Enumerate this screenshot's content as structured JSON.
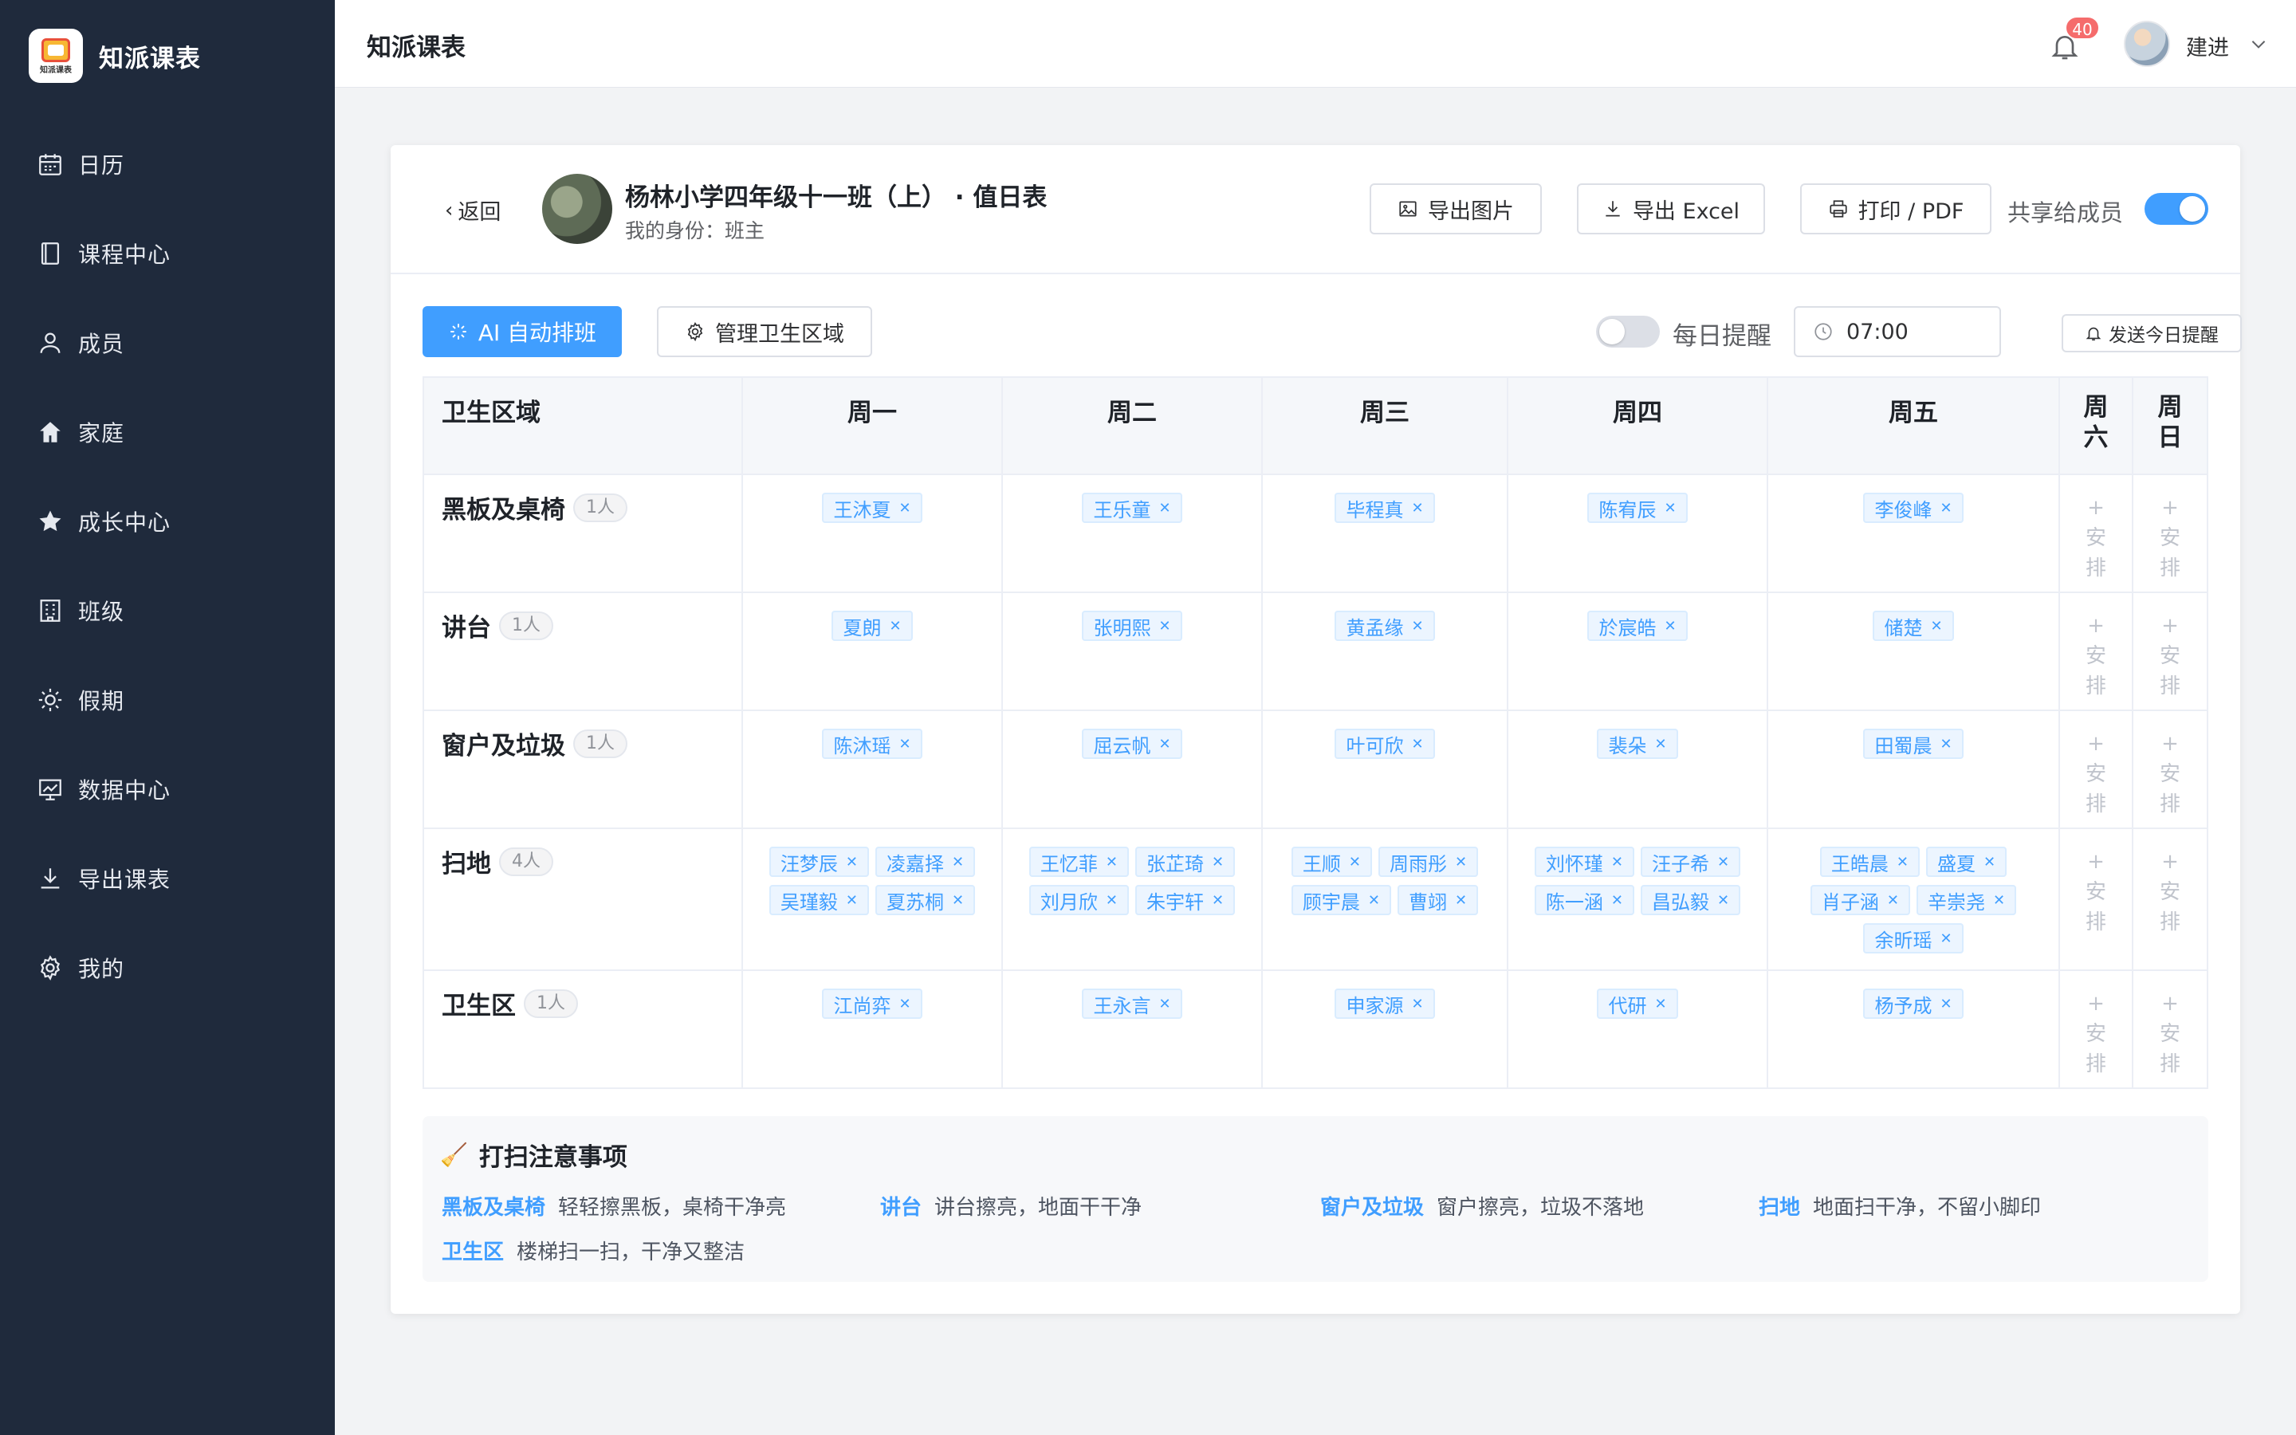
{
  "app": {
    "name": "知派课表",
    "logo_text": "知派课表"
  },
  "sidebar": {
    "items": [
      {
        "label": "日历",
        "icon": "calendar-icon"
      },
      {
        "label": "课程中心",
        "icon": "book-icon"
      },
      {
        "label": "成员",
        "icon": "user-icon"
      },
      {
        "label": "家庭",
        "icon": "home-icon"
      },
      {
        "label": "成长中心",
        "icon": "star-icon"
      },
      {
        "label": "班级",
        "icon": "building-icon"
      },
      {
        "label": "假期",
        "icon": "sun-icon"
      },
      {
        "label": "数据中心",
        "icon": "chart-icon"
      },
      {
        "label": "导出课表",
        "icon": "download-icon"
      },
      {
        "label": "我的",
        "icon": "gear-icon"
      }
    ]
  },
  "topbar": {
    "title": "知派课表",
    "notification_count": "40",
    "user_name": "建进"
  },
  "header": {
    "back_label": "返回",
    "class_title": "杨林小学四年级十一班（上） · 值日表",
    "role_text": "我的身份：班主",
    "export_image_label": "导出图片",
    "export_excel_label": "导出 Excel",
    "print_label": "打印 / PDF",
    "share_label": "共享给成员",
    "share_enabled": true
  },
  "toolbar": {
    "ai_label": "AI 自动排班",
    "manage_label": "管理卫生区域",
    "daily_remind_label": "每日提醒",
    "daily_remind_enabled": false,
    "remind_time": "07:00",
    "send_label": "发送今日提醒"
  },
  "table": {
    "area_header": "卫生区域",
    "weekdays": [
      "周一",
      "周二",
      "周三",
      "周四",
      "周五"
    ],
    "weekend": [
      "周\n六",
      "周\n日"
    ],
    "arrange_label": "+\n安\n排",
    "rows": [
      {
        "area": "黑板及桌椅",
        "count": "1人",
        "days": [
          [
            "王沐夏"
          ],
          [
            "王乐童"
          ],
          [
            "毕程真"
          ],
          [
            "陈宥辰"
          ],
          [
            "李俊峰"
          ]
        ]
      },
      {
        "area": "讲台",
        "count": "1人",
        "days": [
          [
            "夏朗"
          ],
          [
            "张明熙"
          ],
          [
            "黄孟缘"
          ],
          [
            "於宸皓"
          ],
          [
            "储楚"
          ]
        ]
      },
      {
        "area": "窗户及垃圾",
        "count": "1人",
        "days": [
          [
            "陈沐瑶"
          ],
          [
            "屈云帆"
          ],
          [
            "叶可欣"
          ],
          [
            "裴朵"
          ],
          [
            "田蜀晨"
          ]
        ]
      },
      {
        "area": "扫地",
        "count": "4人",
        "days": [
          [
            "汪梦辰",
            "凌嘉择",
            "吴瑾毅",
            "夏苏桐"
          ],
          [
            "王忆菲",
            "张芷琦",
            "刘月欣",
            "朱宇轩"
          ],
          [
            "王顺",
            "周雨彤",
            "顾宇晨",
            "曹翊"
          ],
          [
            "刘怀瑾",
            "汪子希",
            "陈一涵",
            "昌弘毅"
          ],
          [
            "王皓晨",
            "盛夏",
            "肖子涵",
            "辛崇尧",
            "余昕瑶"
          ]
        ]
      },
      {
        "area": "卫生区",
        "count": "1人",
        "days": [
          [
            "江尚弈"
          ],
          [
            "王永言"
          ],
          [
            "申家源"
          ],
          [
            "代研"
          ],
          [
            "杨予成"
          ]
        ]
      }
    ]
  },
  "notes": {
    "title": "打扫注意事项",
    "items": [
      {
        "key": "黑板及桌椅",
        "text": "轻轻擦黑板，桌椅干净亮"
      },
      {
        "key": "讲台",
        "text": "讲台擦亮，地面干干净"
      },
      {
        "key": "窗户及垃圾",
        "text": "窗户擦亮，垃圾不落地"
      },
      {
        "key": "扫地",
        "text": "地面扫干净，不留小脚印"
      },
      {
        "key": "卫生区",
        "text": "楼梯扫一扫，干净又整洁"
      }
    ]
  },
  "colors": {
    "accent": "#409eff",
    "sidebar_bg": "#1f2a3c",
    "badge": "#f56c6c"
  }
}
